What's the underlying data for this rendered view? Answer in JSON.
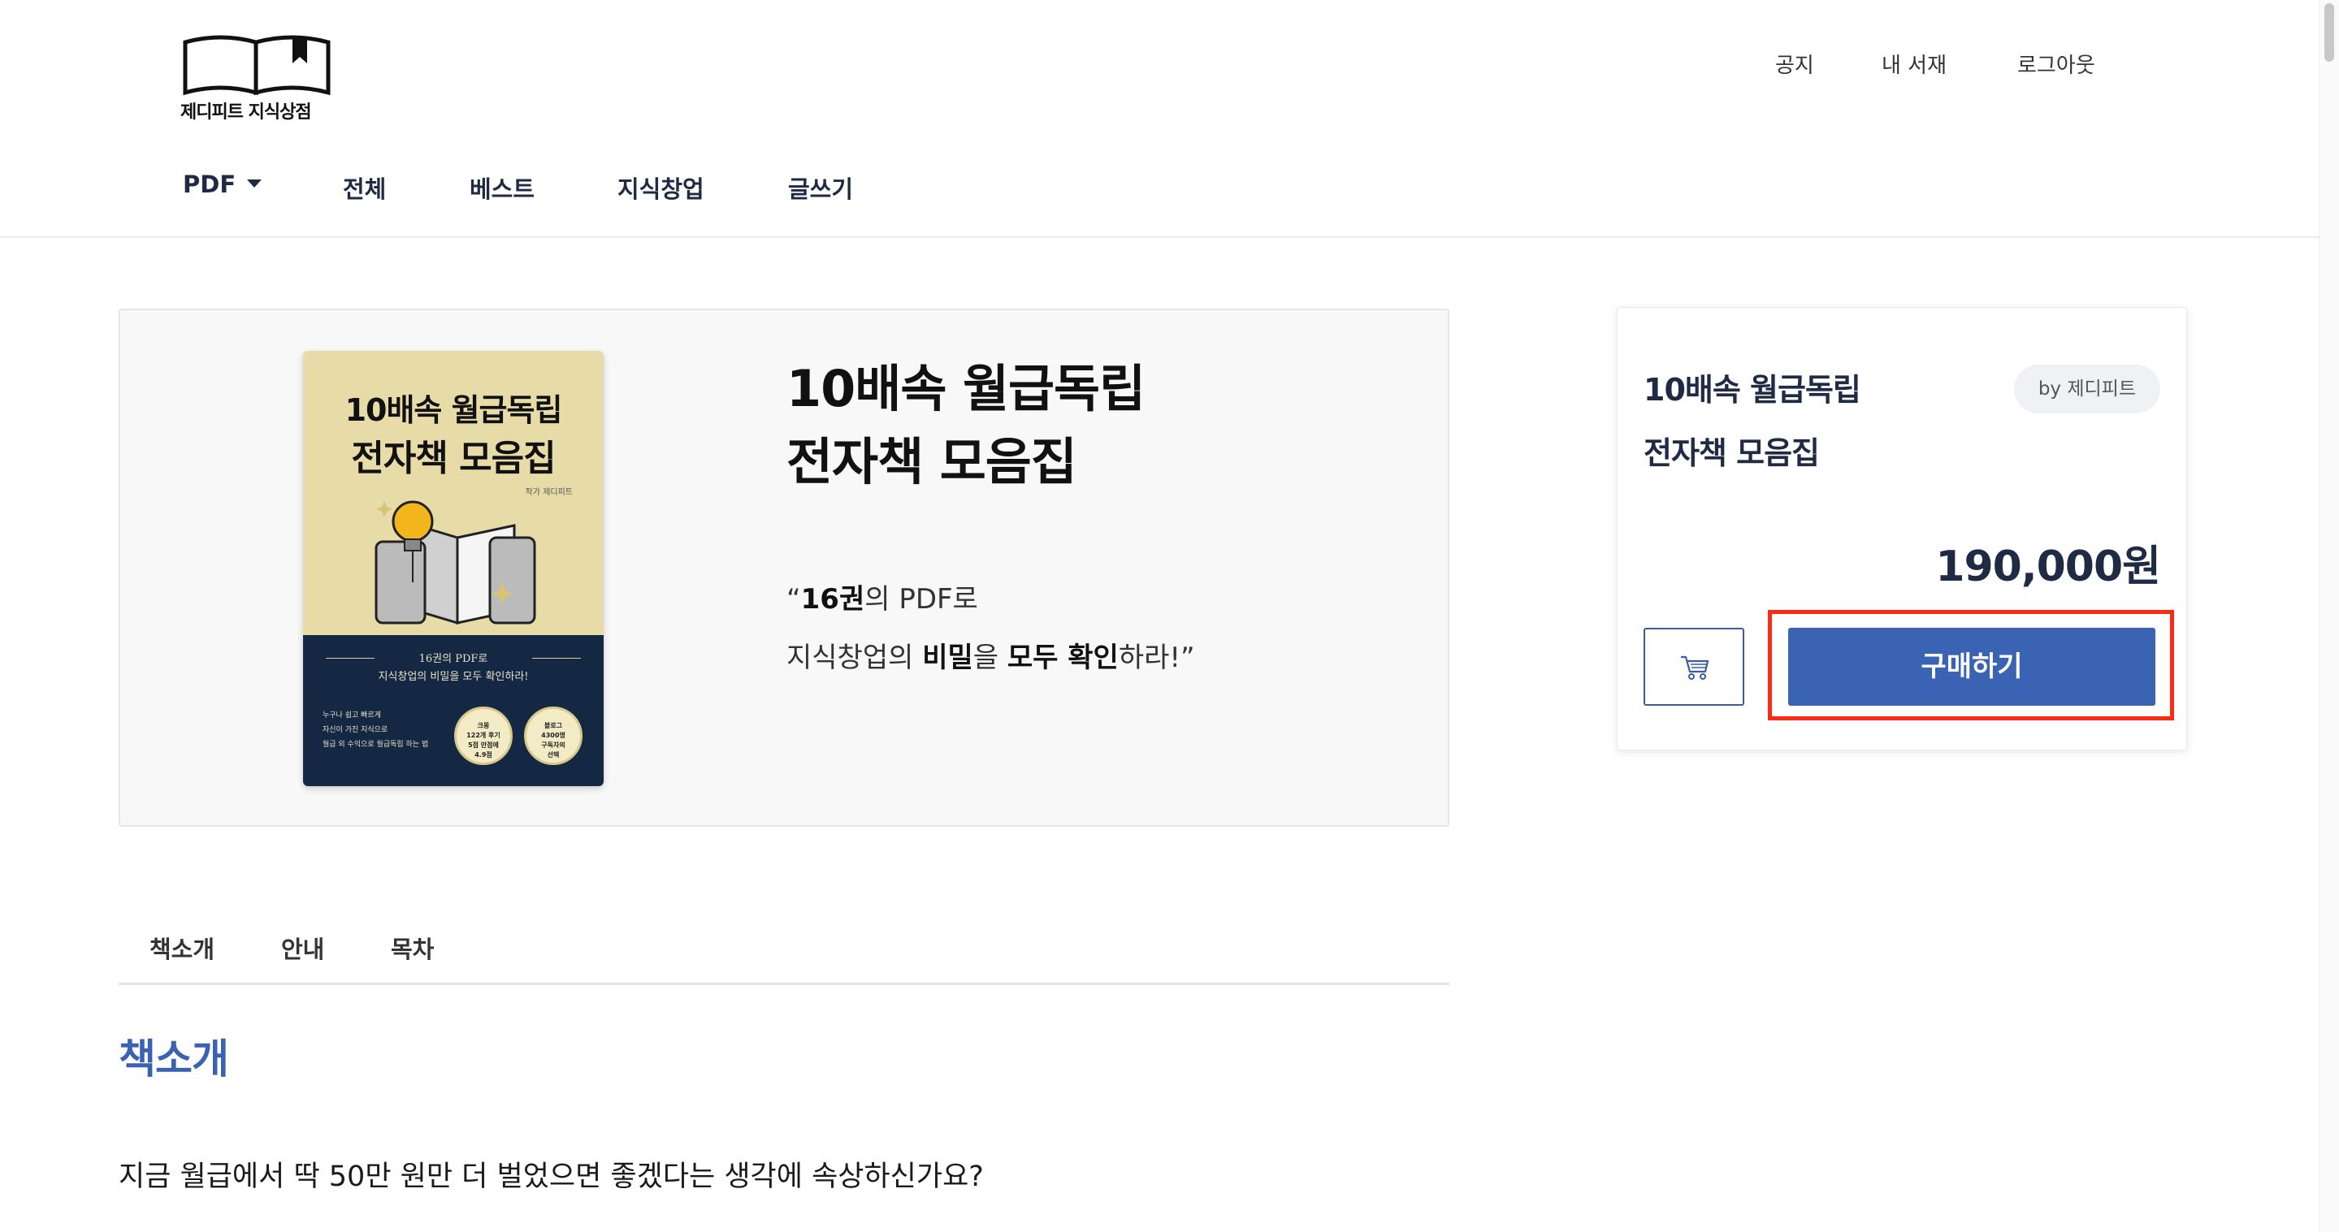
{
  "header": {
    "logo_text": "제디피트 지식상점",
    "top_links": [
      "공지",
      "내 서재",
      "로그아웃"
    ],
    "nav": [
      "PDF",
      "전체",
      "베스트",
      "지식창업",
      "글쓰기"
    ]
  },
  "product": {
    "cover": {
      "title_line1": "10배속 월급독립",
      "title_line2": "전자책 모음집",
      "author": "작가 제디피트",
      "subtitle_line1": "16권의 PDF로",
      "subtitle_line2": "지식창업의 비밀을 모두 확인하라!",
      "tagline_lines": [
        "누구나 쉽고 빠르게",
        "자신이 가진 지식으로",
        "월급 외 수익으로 월급독립 하는 법"
      ],
      "badge1_lines": [
        "크몽",
        "122개 후기",
        "5점 만점에",
        "4.9점"
      ],
      "badge2_lines": [
        "블로그",
        "4300명",
        "구독자의",
        "선택"
      ]
    },
    "title_line1": "10배속 월급독립",
    "title_line2": "전자책 모음집",
    "quote": {
      "open": "“",
      "bold1": "16권",
      "text1": "의 PDF로",
      "text2": "지식창업의 ",
      "bold2": "비밀",
      "text3": "을 ",
      "bold3": "모두 확인",
      "text4": "하라!”"
    }
  },
  "purchase": {
    "title_line1": "10배속 월급독립",
    "title_line2": "전자책 모음집",
    "author_chip": "by 제디피트",
    "price": "190,000원",
    "buy_label": "구매하기",
    "cart_icon": "cart-icon",
    "highlight_color": "#ff2a14",
    "button_color": "#3b63b4"
  },
  "tabs": [
    "책소개",
    "안내",
    "목차"
  ],
  "section": {
    "heading": "책소개",
    "intro": "지금 월급에서 딱 50만 원만 더 벌었으면 좋겠다는 생각에 속상하신가요?"
  }
}
